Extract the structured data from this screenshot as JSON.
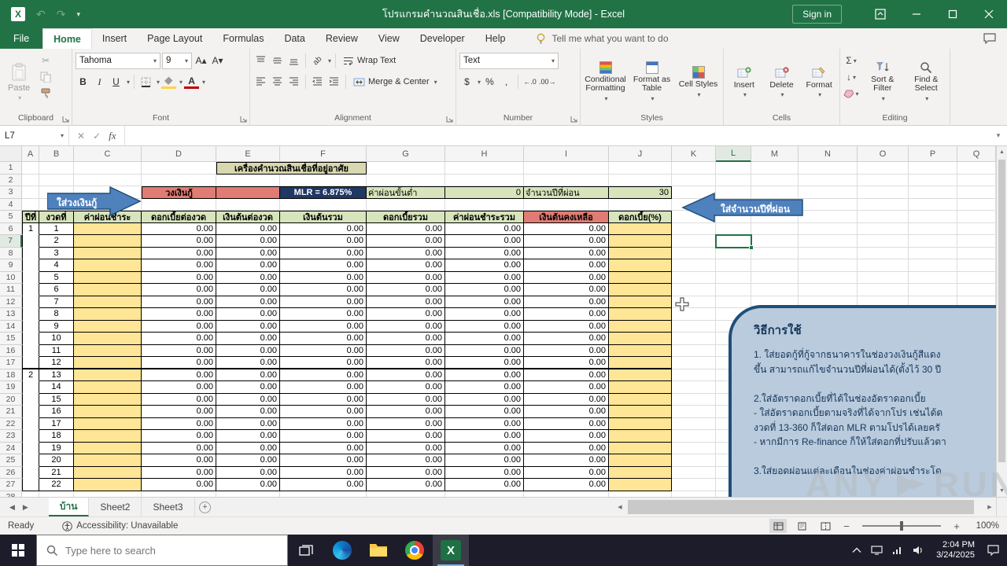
{
  "titlebar": {
    "title": "โปรแกรมคำนวณสินเชื่อ.xls  [Compatibility Mode]  -  Excel",
    "sign_in": "Sign in"
  },
  "ribbon_tabs": {
    "items": [
      "File",
      "Home",
      "Insert",
      "Page Layout",
      "Formulas",
      "Data",
      "Review",
      "View",
      "Developer",
      "Help"
    ],
    "active": "Home",
    "tell_me": "Tell me what you want to do"
  },
  "ribbon": {
    "groups": {
      "clipboard": {
        "label": "Clipboard",
        "paste": "Paste"
      },
      "font": {
        "label": "Font",
        "family": "Tahoma",
        "size": "9"
      },
      "alignment": {
        "label": "Alignment",
        "wrap_text": "Wrap Text",
        "merge_center": "Merge & Center"
      },
      "number": {
        "label": "Number",
        "format": "Text"
      },
      "styles": {
        "label": "Styles",
        "conditional_formatting": "Conditional Formatting",
        "format_as_table": "Format as Table",
        "cell_styles": "Cell Styles"
      },
      "cells": {
        "label": "Cells",
        "insert": "Insert",
        "delete": "Delete",
        "format": "Format"
      },
      "editing": {
        "label": "Editing",
        "sort_filter": "Sort & Filter",
        "find_select": "Find & Select"
      }
    }
  },
  "formula_bar": {
    "name_box": "L7",
    "formula": ""
  },
  "sheet": {
    "col_headers": [
      "A",
      "B",
      "C",
      "D",
      "E",
      "F",
      "G",
      "H",
      "I",
      "J",
      "K",
      "L",
      "M",
      "N",
      "O",
      "P",
      "Q"
    ],
    "calc_title": "เครื่องคำนวณสินเชื่อที่อยู่อาศัย",
    "loan_label": "วงเงินกู้",
    "loan_value": "",
    "mlr": "MLR = 6.875%",
    "min_payment_label": "ค่าผ่อนขั้นต่ำ",
    "min_payment_value": "0",
    "years_label": "จำนวนปีที่ผ่อน",
    "years_value": "30",
    "table_headers": [
      "ปีที่",
      "งวดที่",
      "ค่าผ่อนชำระ",
      "ดอกเบี้ยต่องวด",
      "เงินต้นต่องวด",
      "เงินต้นรวม",
      "ดอกเบี้ยรวม",
      "ค่าผ่อนชำระรวม",
      "เงินต้นคงเหลือ",
      "ดอกเบี้ย(%)"
    ],
    "rows": [
      {
        "year": "1",
        "installment": "1",
        "values": [
          "0.00",
          "0.00",
          "0.00",
          "0.00",
          "0.00",
          "0.00"
        ]
      },
      {
        "year": "",
        "installment": "2",
        "values": [
          "0.00",
          "0.00",
          "0.00",
          "0.00",
          "0.00",
          "0.00"
        ]
      },
      {
        "year": "",
        "installment": "3",
        "values": [
          "0.00",
          "0.00",
          "0.00",
          "0.00",
          "0.00",
          "0.00"
        ]
      },
      {
        "year": "",
        "installment": "4",
        "values": [
          "0.00",
          "0.00",
          "0.00",
          "0.00",
          "0.00",
          "0.00"
        ]
      },
      {
        "year": "",
        "installment": "5",
        "values": [
          "0.00",
          "0.00",
          "0.00",
          "0.00",
          "0.00",
          "0.00"
        ]
      },
      {
        "year": "",
        "installment": "6",
        "values": [
          "0.00",
          "0.00",
          "0.00",
          "0.00",
          "0.00",
          "0.00"
        ]
      },
      {
        "year": "",
        "installment": "7",
        "values": [
          "0.00",
          "0.00",
          "0.00",
          "0.00",
          "0.00",
          "0.00"
        ]
      },
      {
        "year": "",
        "installment": "8",
        "values": [
          "0.00",
          "0.00",
          "0.00",
          "0.00",
          "0.00",
          "0.00"
        ]
      },
      {
        "year": "",
        "installment": "9",
        "values": [
          "0.00",
          "0.00",
          "0.00",
          "0.00",
          "0.00",
          "0.00"
        ]
      },
      {
        "year": "",
        "installment": "10",
        "values": [
          "0.00",
          "0.00",
          "0.00",
          "0.00",
          "0.00",
          "0.00"
        ]
      },
      {
        "year": "",
        "installment": "11",
        "values": [
          "0.00",
          "0.00",
          "0.00",
          "0.00",
          "0.00",
          "0.00"
        ]
      },
      {
        "year": "",
        "installment": "12",
        "values": [
          "0.00",
          "0.00",
          "0.00",
          "0.00",
          "0.00",
          "0.00"
        ]
      },
      {
        "year": "2",
        "installment": "13",
        "values": [
          "0.00",
          "0.00",
          "0.00",
          "0.00",
          "0.00",
          "0.00"
        ]
      },
      {
        "year": "",
        "installment": "14",
        "values": [
          "0.00",
          "0.00",
          "0.00",
          "0.00",
          "0.00",
          "0.00"
        ]
      },
      {
        "year": "",
        "installment": "15",
        "values": [
          "0.00",
          "0.00",
          "0.00",
          "0.00",
          "0.00",
          "0.00"
        ]
      },
      {
        "year": "",
        "installment": "16",
        "values": [
          "0.00",
          "0.00",
          "0.00",
          "0.00",
          "0.00",
          "0.00"
        ]
      },
      {
        "year": "",
        "installment": "17",
        "values": [
          "0.00",
          "0.00",
          "0.00",
          "0.00",
          "0.00",
          "0.00"
        ]
      },
      {
        "year": "",
        "installment": "18",
        "values": [
          "0.00",
          "0.00",
          "0.00",
          "0.00",
          "0.00",
          "0.00"
        ]
      },
      {
        "year": "",
        "installment": "19",
        "values": [
          "0.00",
          "0.00",
          "0.00",
          "0.00",
          "0.00",
          "0.00"
        ]
      },
      {
        "year": "",
        "installment": "20",
        "values": [
          "0.00",
          "0.00",
          "0.00",
          "0.00",
          "0.00",
          "0.00"
        ]
      },
      {
        "year": "",
        "installment": "21",
        "values": [
          "0.00",
          "0.00",
          "0.00",
          "0.00",
          "0.00",
          "0.00"
        ]
      },
      {
        "year": "",
        "installment": "22",
        "values": [
          "0.00",
          "0.00",
          "0.00",
          "0.00",
          "0.00",
          "0.00"
        ]
      }
    ],
    "arrow_loan": "ใส่วงเงินกู้",
    "arrow_years": "ใส่จำนวนปีที่ผ่อน",
    "selection": "L7",
    "note": {
      "title": "วิธีการใช้",
      "lines": [
        "1. ใส่ยอดกู้ที่กู้จากธนาคารในช่องวงเงินกู้สีแดง",
        "ขึ้น สามารถแก้ไขจำนวนปีที่ผ่อนได้(ตั้งไว้ 30 ปี",
        "",
        "2.ใส่อัตราดอกเบี้ยที่ได้ในช่องอัตราดอกเบี้ย",
        "- ใส่อัตราดอกเบี้ยตามจริงที่ได้จากโปร เช่นได้ด",
        "งวดที่ 13-360 ก็ใส่ดอก MLR ตามโปรได้เลยครั",
        "- หากมีการ Re-finance ก็ให้ใส่ดอกที่ปรับแล้วตา",
        "",
        "3.ใส่ยอดผ่อนแต่ละเดือนในช่องค่าผ่อนชำระโด"
      ]
    }
  },
  "sheet_tabs": {
    "sheets": [
      "บ้าน",
      "Sheet2",
      "Sheet3"
    ],
    "active": "บ้าน"
  },
  "status": {
    "ready": "Ready",
    "accessibility": "Accessibility: Unavailable",
    "zoom_level": "100%"
  },
  "taskbar": {
    "search_placeholder": "Type here to search",
    "time": "2:04 PM",
    "date": "3/24/2025"
  },
  "watermark": {
    "left": "ANY",
    "right": "RUN"
  }
}
